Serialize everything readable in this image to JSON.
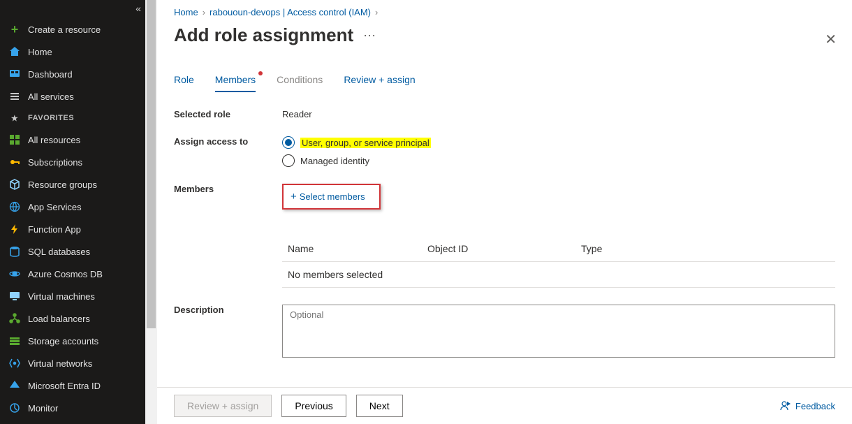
{
  "sidebar": {
    "items": [
      {
        "icon": "plus",
        "color": "#5aa92f",
        "label": "Create a resource"
      },
      {
        "icon": "home",
        "color": "#37a3eb",
        "label": "Home"
      },
      {
        "icon": "dash",
        "color": "#37a3eb",
        "label": "Dashboard"
      },
      {
        "icon": "list",
        "color": "#c8c8c8",
        "label": "All services"
      }
    ],
    "favorites_header": "FAVORITES",
    "favorites": [
      {
        "icon": "grid",
        "color": "#5aa92f",
        "label": "All resources"
      },
      {
        "icon": "key",
        "color": "#ffb900",
        "label": "Subscriptions"
      },
      {
        "icon": "cube",
        "color": "#8fd3fe",
        "label": "Resource groups"
      },
      {
        "icon": "globe",
        "color": "#37a3eb",
        "label": "App Services"
      },
      {
        "icon": "bolt",
        "color": "#ffb900",
        "label": "Function App"
      },
      {
        "icon": "db",
        "color": "#37a3eb",
        "label": "SQL databases"
      },
      {
        "icon": "cosmos",
        "color": "#37a3eb",
        "label": "Azure Cosmos DB"
      },
      {
        "icon": "vm",
        "color": "#8fd3fe",
        "label": "Virtual machines"
      },
      {
        "icon": "lb",
        "color": "#5aa92f",
        "label": "Load balancers"
      },
      {
        "icon": "storage",
        "color": "#5aa92f",
        "label": "Storage accounts"
      },
      {
        "icon": "vnet",
        "color": "#37a3eb",
        "label": "Virtual networks"
      },
      {
        "icon": "entra",
        "color": "#37a3eb",
        "label": "Microsoft Entra ID"
      },
      {
        "icon": "monitor",
        "color": "#37a3eb",
        "label": "Monitor"
      }
    ]
  },
  "breadcrumb": {
    "items": [
      "Home",
      "rabououn-devops | Access control (IAM)"
    ]
  },
  "page": {
    "title": "Add role assignment",
    "tabs": {
      "role": "Role",
      "members": "Members",
      "conditions": "Conditions",
      "review": "Review + assign"
    },
    "selected_role_label": "Selected role",
    "selected_role_value": "Reader",
    "assign_access_label": "Assign access to",
    "radio_user_group": "User, group, or service principal",
    "radio_managed": "Managed identity",
    "members_label": "Members",
    "select_members": "Select members",
    "members_table": {
      "col_name": "Name",
      "col_object_id": "Object ID",
      "col_type": "Type",
      "empty": "No members selected"
    },
    "description_label": "Description",
    "description_placeholder": "Optional"
  },
  "footer": {
    "review": "Review + assign",
    "previous": "Previous",
    "next": "Next",
    "feedback": "Feedback"
  }
}
